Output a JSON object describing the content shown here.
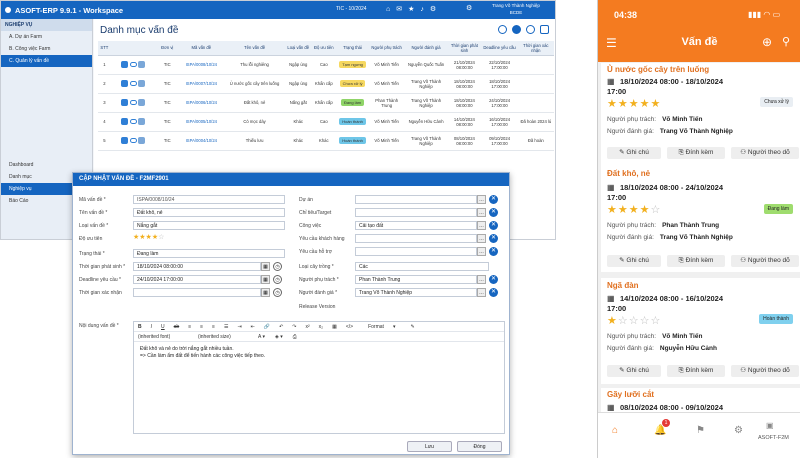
{
  "erp": {
    "title": "ASOFT-ERP 9.9.1 - Workspace",
    "period": "TIC - 10/2024",
    "user_name": "Trang Võ Thành Nghiệp",
    "user_company": "BCDE",
    "sidebar_header": "NGHIỆP VỤ",
    "sidebar_items": [
      {
        "label": "A. Dự án Farm"
      },
      {
        "label": "B. Công việc Farm"
      },
      {
        "label": "C. Quản lý vấn đề"
      }
    ],
    "sidebar_bottom": [
      {
        "label": "Dashboard"
      },
      {
        "label": "Danh mục"
      },
      {
        "label": "Nghiệp vụ"
      },
      {
        "label": "Báo Cáo"
      }
    ],
    "page_title": "Danh mục vấn đề",
    "columns": [
      "STT",
      "",
      "Đơn vị",
      "Mã vấn đề",
      "Tên vấn đề",
      "Loại vấn đề",
      "Độ ưu tiên",
      "Trạng thái",
      "Người phụ trách",
      "Người đánh giá",
      "Thời gian phát sinh",
      "Deadline yêu cầu",
      "Thời gian xác nhận"
    ],
    "rows": [
      {
        "stt": "1",
        "unit": "TIC",
        "code": "ISPA/0008/10/24",
        "name": "Thu lỗi nghiêng",
        "type": "Ngập úng",
        "priority": "Cao",
        "status": "Tạm ngưng",
        "status_color": "#f6d860",
        "owner": "Võ Minh Tiến",
        "reviewer": "Nguyễn Quốc Tuấn",
        "arise": "21/10/2024 08:00:00",
        "deadline": "22/10/2024 17:00:00",
        "confirm": ""
      },
      {
        "stt": "2",
        "unit": "TIC",
        "code": "ISPA/0007/10/24",
        "name": "Ủ nước gốc cây trên luống",
        "type": "Ngập úng",
        "priority": "Khẩn cấp",
        "status": "Chưa xử lý",
        "status_color": "#f6d860",
        "owner": "Võ Minh Tiến",
        "reviewer": "Trang Võ Thành Nghiệp",
        "arise": "18/10/2024 08:00:00",
        "deadline": "18/10/2024 17:00:00",
        "confirm": ""
      },
      {
        "stt": "3",
        "unit": "TIC",
        "code": "ISPA/0006/10/24",
        "name": "Đất khô, nẻ",
        "type": "Nắng gắt",
        "priority": "Khẩn cấp",
        "status": "Đang làm",
        "status_color": "#8fd468",
        "owner": "Phan Thành Trung",
        "reviewer": "Trang Võ Thành Nghiệp",
        "arise": "18/10/2024 08:00:00",
        "deadline": "24/10/2024 17:00:00",
        "confirm": ""
      },
      {
        "stt": "4",
        "unit": "TIC",
        "code": "ISPA/0005/10/24",
        "name": "Cỏ mọc dày",
        "type": "Khác",
        "priority": "Cao",
        "status": "Hoàn thành",
        "status_color": "#6ec6e8",
        "owner": "Võ Minh Tiến",
        "reviewer": "Nguyễn Hữu Cảnh",
        "arise": "14/10/2024 08:00:00",
        "deadline": "16/10/2024 17:00:00",
        "confirm": "Đã hoàn 2024 lú"
      },
      {
        "stt": "5",
        "unit": "TIC",
        "code": "ISPA/0004/10/24",
        "name": "Thiếu lưu",
        "type": "Khác",
        "priority": "Khác",
        "status": "Hoàn thành",
        "status_color": "#6ec6e8",
        "owner": "Võ Minh Tiến",
        "reviewer": "Trang Võ Thành Nghiệp",
        "arise": "08/10/2024 08:00:00",
        "deadline": "09/10/2024 17:00:00",
        "confirm": "Đã hoàn"
      }
    ]
  },
  "dialog": {
    "title": "CẬP NHẬT VẤN ĐỀ - F2MF2901",
    "labels": {
      "code": "Mã vấn đề *",
      "name": "Tên vấn đề *",
      "type": "Loại vấn đề *",
      "priority": "Độ ưu tiên",
      "status": "Trạng thái *",
      "arise": "Thời gian phát sinh *",
      "deadline": "Deadline yêu cầu *",
      "confirm": "Thời gian xác nhận",
      "project": "Dự án",
      "target": "Chỉ tiêu/Target",
      "task": "Công việc",
      "cust_req": "Yêu cầu khách hàng",
      "support_req": "Yêu cầu hỗ trợ",
      "crop": "Loại cây trồng *",
      "owner": "Người phụ trách *",
      "reviewer": "Người đánh giá *",
      "release": "Release Version",
      "content": "Nội dung vấn đề *"
    },
    "values": {
      "code": "ISPA/0008/10/24",
      "name": "Đất khô, nẻ",
      "type": "Nắng gắt",
      "priority_stars": 4,
      "status": "Đang làm",
      "arise": "18/10/2024 08:00:00",
      "deadline": "24/10/2024 17:00:00",
      "task": "Cải tạo đất",
      "crop": "Các",
      "owner": "Phan Thành Trung",
      "reviewer": "Trang Võ Thành Nghiệp"
    },
    "editor": {
      "font": "(inherited font)",
      "size": "(inherited size)",
      "format": "Format",
      "line1": "Đất khô và nẻ do trời nắng gắt nhiều tuần.",
      "line2": "=> Cần làm ẩm đất để tiến hành các công việc tiếp theo."
    },
    "save_label": "Lưu",
    "close_label": "Đóng"
  },
  "mobile": {
    "time": "04:38",
    "title": "Vấn đề",
    "cards": [
      {
        "title": "Ủ nước gốc cây trên luống",
        "date": "18/10/2024 08:00 - 18/10/2024",
        "time": "17:00",
        "stars": 5,
        "badge": "Chưa xử lý",
        "badge_color": "#e9eef3",
        "owner_label": "Người phụ trách:",
        "owner": "Võ Minh Tiến",
        "reviewer_label": "Người đánh giá:",
        "reviewer": "Trang Võ Thành Nghiệp"
      },
      {
        "title": "Đất khô, nẻ",
        "date": "18/10/2024 08:00 - 24/10/2024",
        "time": "17:00",
        "stars": 4,
        "badge": "Đang làm",
        "badge_color": "#9fdc6e",
        "owner_label": "Người phụ trách:",
        "owner": "Phan Thành Trung",
        "reviewer_label": "Người đánh giá:",
        "reviewer": "Trang Võ Thành Nghiệp"
      },
      {
        "title": "Ngã đàn",
        "date": "14/10/2024 08:00 - 16/10/2024",
        "time": "17:00",
        "stars": 1,
        "badge": "Hoàn thành",
        "badge_color": "#7fd0ee",
        "owner_label": "Người phụ trách:",
        "owner": "Võ Minh Tiến",
        "reviewer_label": "Người đánh giá:",
        "reviewer": "Nguyễn Hữu Cảnh"
      },
      {
        "title": "Gãy lưỡi cắt",
        "date": "08/10/2024 08:00 - 09/10/2024"
      }
    ],
    "btn_note": "Ghi chú",
    "btn_attach": "Đính kèm",
    "btn_follow": "Người theo dõ",
    "nav_badge": "1",
    "nav_label": "ASOFT-F2M"
  }
}
